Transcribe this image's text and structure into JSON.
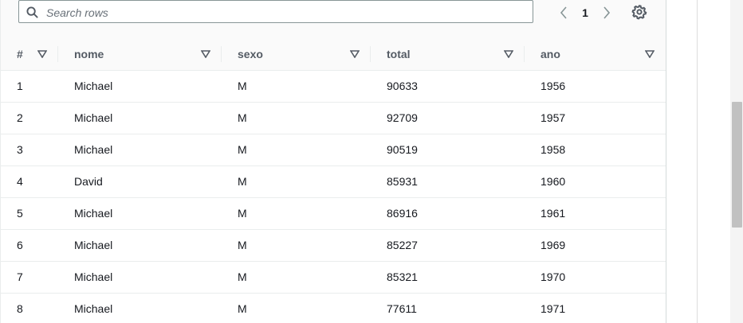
{
  "toolbar": {
    "search_placeholder": "Search rows",
    "current_page": "1",
    "icons": {
      "search": "search-icon",
      "prev": "chevron-left-icon",
      "next": "chevron-right-icon",
      "settings": "gear-icon",
      "sort": "sort-caret-icon"
    }
  },
  "table": {
    "columns": [
      "#",
      "nome",
      "sexo",
      "total",
      "ano"
    ],
    "rows": [
      [
        "1",
        "Michael",
        "M",
        "90633",
        "1956"
      ],
      [
        "2",
        "Michael",
        "M",
        "92709",
        "1957"
      ],
      [
        "3",
        "Michael",
        "M",
        "90519",
        "1958"
      ],
      [
        "4",
        "David",
        "M",
        "85931",
        "1960"
      ],
      [
        "5",
        "Michael",
        "M",
        "86916",
        "1961"
      ],
      [
        "6",
        "Michael",
        "M",
        "85227",
        "1969"
      ],
      [
        "7",
        "Michael",
        "M",
        "85321",
        "1970"
      ],
      [
        "8",
        "Michael",
        "M",
        "77611",
        "1971"
      ]
    ]
  },
  "colors": {
    "text": "#16191f",
    "header_text": "#545b64",
    "border": "#eaeded",
    "toolbar_bg": "#fafafa"
  }
}
